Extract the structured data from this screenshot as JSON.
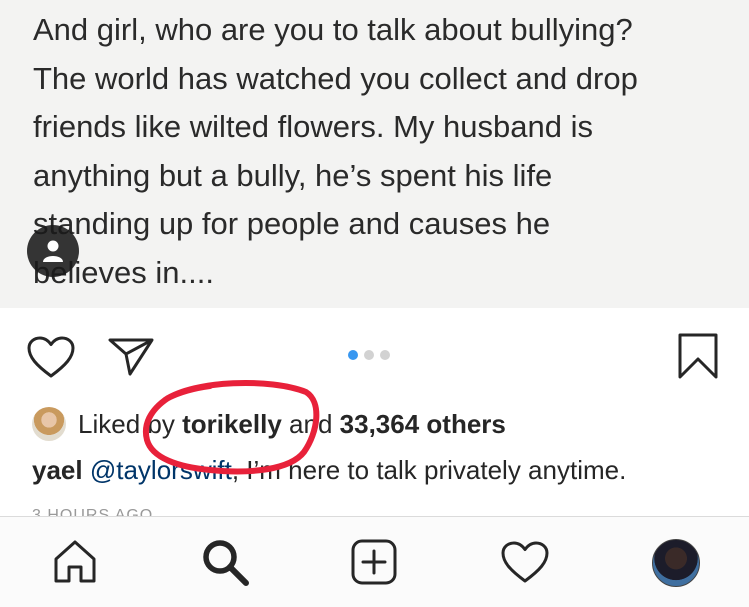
{
  "post": {
    "text_lines": [
      "And girl, who are you to talk about bullying?",
      "The world has watched you collect and drop",
      "friends like wilted flowers. My husband is",
      "anything but a bully, he’s spent his life",
      "standing up for people and causes he",
      "believes in...."
    ],
    "carousel": {
      "count": 3,
      "active_index": 0
    }
  },
  "likes": {
    "prefix": "Liked by",
    "liker": "torikelly",
    "joiner": "and",
    "others": "33,364 others"
  },
  "caption": {
    "username": "yael",
    "mention": "@taylorswift",
    "text": ", I’m here to talk privately anytime."
  },
  "timestamp": "3 HOURS AGO",
  "colors": {
    "accent": "#3897f0",
    "annotation": "#e8213a",
    "text": "#262626"
  },
  "icons": {
    "user_tag": "person-icon",
    "like": "heart-icon",
    "share": "paper-plane-icon",
    "save": "bookmark-icon",
    "nav_home": "home-icon",
    "nav_search": "search-icon",
    "nav_add": "plus-square-icon",
    "nav_activity": "heart-icon"
  }
}
